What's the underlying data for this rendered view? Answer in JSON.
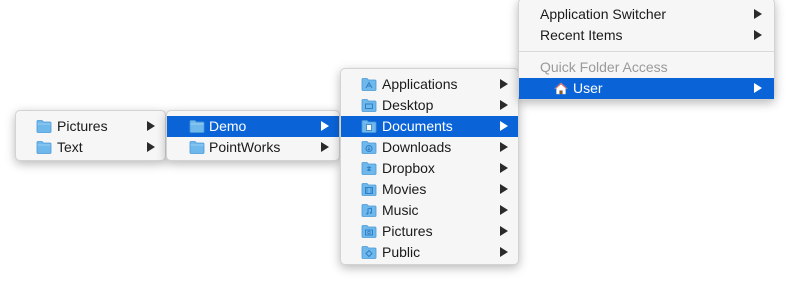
{
  "menus": {
    "level1": {
      "items": [
        {
          "label": "Pictures",
          "icon": "folder-icon"
        },
        {
          "label": "Text",
          "icon": "folder-icon"
        }
      ]
    },
    "level2": {
      "items": [
        {
          "label": "Demo",
          "icon": "folder-icon",
          "selected": true
        },
        {
          "label": "PointWorks",
          "icon": "folder-icon"
        }
      ]
    },
    "level3": {
      "items": [
        {
          "label": "Applications",
          "icon": "applications-folder-icon"
        },
        {
          "label": "Desktop",
          "icon": "desktop-folder-icon"
        },
        {
          "label": "Documents",
          "icon": "documents-folder-icon",
          "selected": true
        },
        {
          "label": "Downloads",
          "icon": "downloads-folder-icon"
        },
        {
          "label": "Dropbox",
          "icon": "dropbox-folder-icon"
        },
        {
          "label": "Movies",
          "icon": "movies-folder-icon"
        },
        {
          "label": "Music",
          "icon": "music-folder-icon"
        },
        {
          "label": "Pictures",
          "icon": "pictures-folder-icon"
        },
        {
          "label": "Public",
          "icon": "public-folder-icon"
        }
      ]
    },
    "level4": {
      "items": [
        {
          "label": "Application Switcher"
        },
        {
          "label": "Recent Items"
        }
      ],
      "section_header": "Quick Folder Access",
      "user_item": {
        "label": "User",
        "icon": "home-icon",
        "selected": true
      }
    }
  },
  "colors": {
    "selection": "#0a64d8",
    "menu_background": "#f6f6f6",
    "folder_blue": "#6fb8ec",
    "header_text": "#9a9a9a"
  }
}
